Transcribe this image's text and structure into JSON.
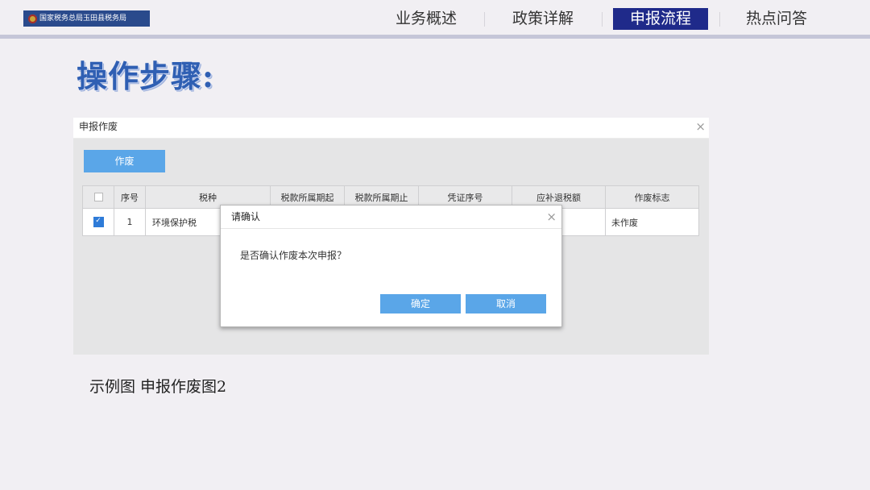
{
  "header": {
    "logo_text": "国家税务总局玉田县税务局",
    "nav": [
      "业务概述",
      "政策详解",
      "申报流程",
      "热点问答"
    ],
    "active_nav_index": 2
  },
  "heading": "操作步骤:",
  "screenshot": {
    "window_title": "申报作废",
    "close_glyph": "×",
    "void_button": "作废",
    "table": {
      "columns": [
        "序号",
        "税种",
        "税款所属期起",
        "税款所属期止",
        "凭证序号",
        "应补退税额",
        "作废标志"
      ],
      "rows": [
        {
          "checked": true,
          "index": "1",
          "tax_type": "环境保护税",
          "period_start": "",
          "period_end": "",
          "voucher_no": "",
          "amount": "",
          "void_flag": "未作废"
        }
      ]
    },
    "confirm_dialog": {
      "title": "请确认",
      "message": "是否确认作废本次申报？",
      "ok_label": "确定",
      "cancel_label": "取消"
    }
  },
  "caption": "示例图  申报作废图2",
  "colors": {
    "accent_blue": "#5aa6e8",
    "nav_active_bg": "#1f2a8a",
    "heading_blue": "#2f5fb3"
  }
}
